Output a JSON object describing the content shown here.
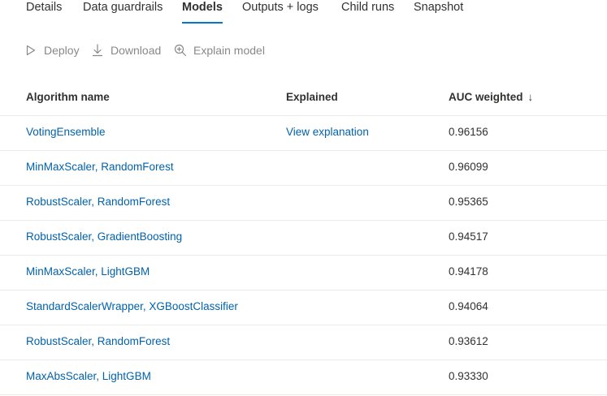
{
  "tabs": [
    {
      "label": "Details",
      "active": false
    },
    {
      "label": "Data guardrails",
      "active": false
    },
    {
      "label": "Models",
      "active": true
    },
    {
      "label": "Outputs + logs",
      "active": false
    },
    {
      "label": "Child runs",
      "active": false
    },
    {
      "label": "Snapshot",
      "active": false
    }
  ],
  "commands": {
    "deploy": {
      "label": "Deploy",
      "icon": "play-icon"
    },
    "download": {
      "label": "Download",
      "icon": "download-icon"
    },
    "explain": {
      "label": "Explain model",
      "icon": "zoom-search-icon"
    }
  },
  "table": {
    "columns": {
      "algorithm": "Algorithm name",
      "explained": "Explained",
      "auc": "AUC weighted",
      "auc_sort_icon": "↓"
    },
    "rows": [
      {
        "algorithm": "VotingEnsemble",
        "explained": "View explanation",
        "auc": "0.96156"
      },
      {
        "algorithm": "MinMaxScaler, RandomForest",
        "explained": "",
        "auc": "0.96099"
      },
      {
        "algorithm": "RobustScaler, RandomForest",
        "explained": "",
        "auc": "0.95365"
      },
      {
        "algorithm": "RobustScaler, GradientBoosting",
        "explained": "",
        "auc": "0.94517"
      },
      {
        "algorithm": "MinMaxScaler, LightGBM",
        "explained": "",
        "auc": "0.94178"
      },
      {
        "algorithm": "StandardScalerWrapper, XGBoostClassifier",
        "explained": "",
        "auc": "0.94064"
      },
      {
        "algorithm": "RobustScaler, RandomForest",
        "explained": "",
        "auc": "0.93612"
      },
      {
        "algorithm": "MaxAbsScaler, LightGBM",
        "explained": "",
        "auc": "0.93330"
      }
    ]
  },
  "colors": {
    "accent": "#0078d4",
    "link": "#0062ad",
    "disabled": "#8a8886",
    "divider": "#edebe9"
  }
}
